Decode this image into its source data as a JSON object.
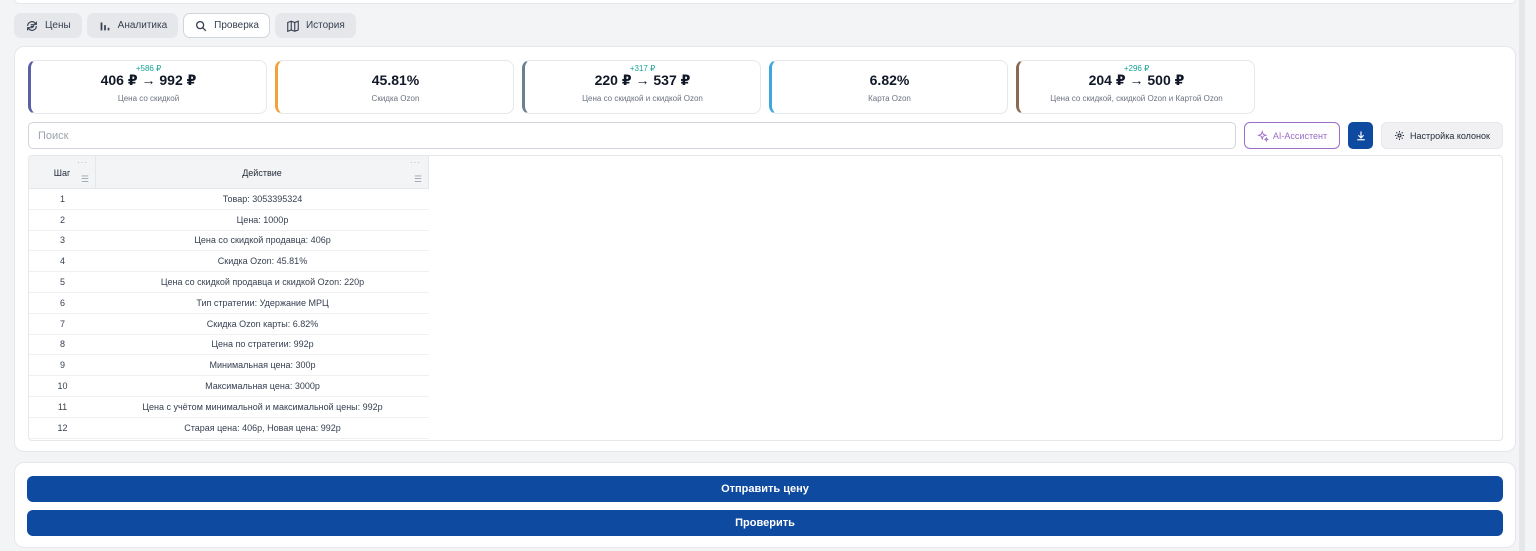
{
  "tabs": [
    {
      "label": "Цены",
      "icon": "price-cycle-icon"
    },
    {
      "label": "Аналитика",
      "icon": "bar-chart-icon"
    },
    {
      "label": "Проверка",
      "icon": "search-icon"
    },
    {
      "label": "История",
      "icon": "map-icon"
    }
  ],
  "active_tab": "Проверка",
  "stats": [
    {
      "delta": "+586 ₽",
      "value": "406 ₽ → 992 ₽",
      "label": "Цена со скидкой",
      "color": "#5b5fa6"
    },
    {
      "delta": "",
      "value": "45.81%",
      "label": "Скидка Ozon",
      "color": "#f2a23a"
    },
    {
      "delta": "+317 ₽",
      "value": "220 ₽ → 537 ₽",
      "label": "Цена со скидкой и скидкой Ozon",
      "color": "#6b7f8e"
    },
    {
      "delta": "",
      "value": "6.82%",
      "label": "Карта Ozon",
      "color": "#3ea7de"
    },
    {
      "delta": "+296 ₽",
      "value": "204 ₽ → 500 ₽",
      "label": "Цена со скидкой, скидкой Ozon и Картой Ozon",
      "color": "#8a6a52"
    }
  ],
  "search": {
    "placeholder": "Поиск"
  },
  "toolbar": {
    "ai_label": "AI-Ассистент",
    "columns_label": "Настройка колонок"
  },
  "table": {
    "columns": [
      "Шаг",
      "Действие"
    ],
    "rows": [
      [
        "1",
        "Товар: 3053395324"
      ],
      [
        "2",
        "Цена: 1000р"
      ],
      [
        "3",
        "Цена со скидкой продавца: 406р"
      ],
      [
        "4",
        "Скидка Ozon: 45.81%"
      ],
      [
        "5",
        "Цена со скидкой продавца и скидкой Ozon: 220р"
      ],
      [
        "6",
        "Тип стратегии: Удержание МРЦ"
      ],
      [
        "7",
        "Скидка Ozon карты: 6.82%"
      ],
      [
        "8",
        "Цена по стратегии: 992р"
      ],
      [
        "9",
        "Минимальная цена: 300р"
      ],
      [
        "10",
        "Максимальная цена: 3000р"
      ],
      [
        "11",
        "Цена с учётом минимальной и максимальной цены: 992р"
      ],
      [
        "12",
        "Старая цена: 406р, Новая цена: 992р"
      ]
    ]
  },
  "actions": {
    "send_label": "Отправить цену",
    "check_label": "Проверить"
  },
  "colors": {
    "primary": "#0f4aa1",
    "ai_accent": "#9b6cc8",
    "delta_green": "#16a394"
  }
}
